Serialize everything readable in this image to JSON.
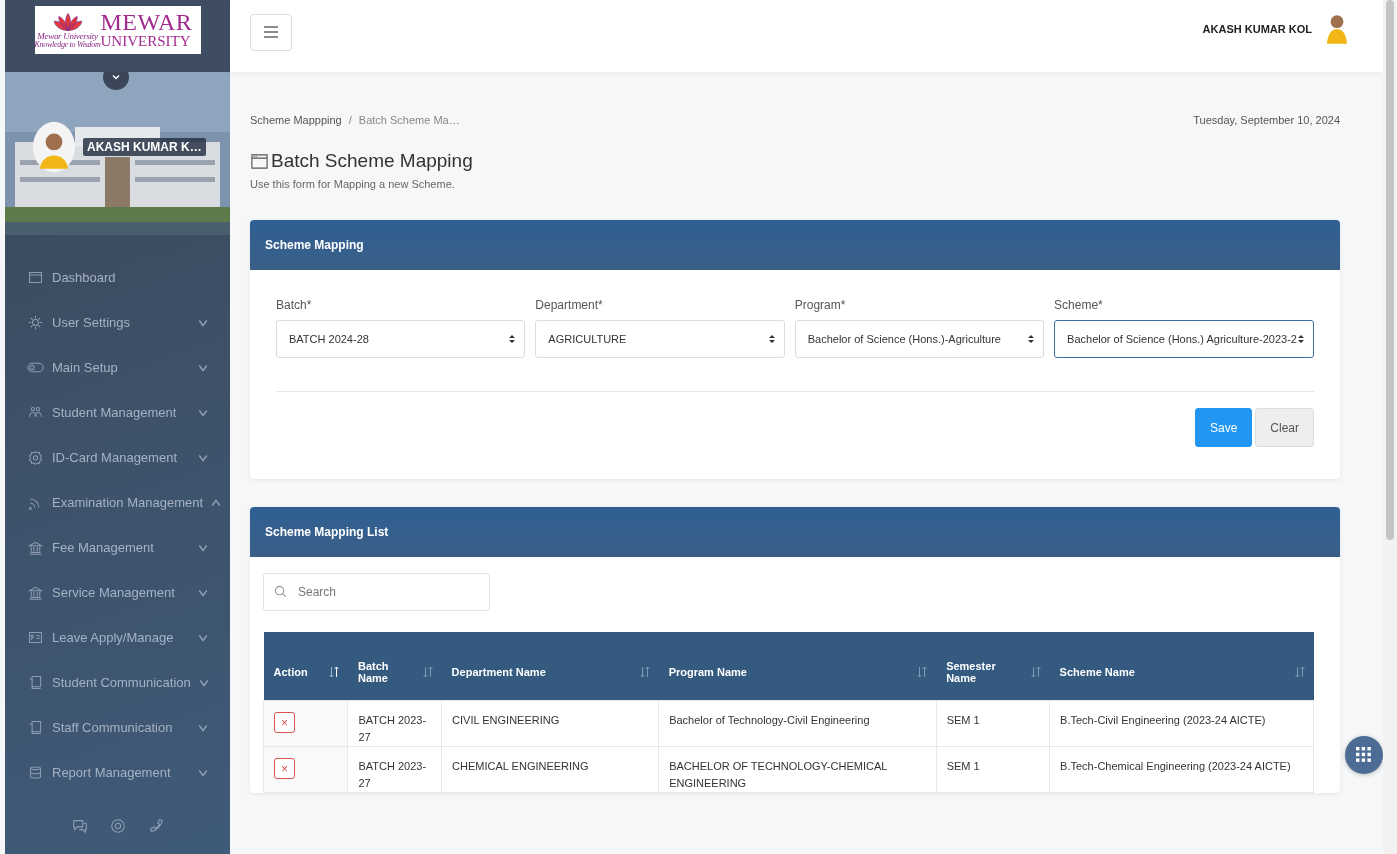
{
  "logo": {
    "title": "MEWAR",
    "subtitle": "UNIVERSITY",
    "motto": "Mewar University",
    "tagline": "Knowledge to Wisdom"
  },
  "sidebar": {
    "user": "AKASH KUMAR K…",
    "items": [
      {
        "label": "Dashboard",
        "expandable": false
      },
      {
        "label": "User Settings",
        "expandable": true,
        "expanded": false
      },
      {
        "label": "Main Setup",
        "expandable": true,
        "expanded": false
      },
      {
        "label": "Student Management",
        "expandable": true,
        "expanded": false
      },
      {
        "label": "ID-Card Management",
        "expandable": true,
        "expanded": false
      },
      {
        "label": "Examination Management",
        "expandable": true,
        "expanded": true
      },
      {
        "label": "Fee Management",
        "expandable": true,
        "expanded": false
      },
      {
        "label": "Service Management",
        "expandable": true,
        "expanded": false
      },
      {
        "label": "Leave Apply/Manage",
        "expandable": true,
        "expanded": false
      },
      {
        "label": "Student Communication",
        "expandable": true,
        "expanded": false
      },
      {
        "label": "Staff Communication",
        "expandable": true,
        "expanded": false
      },
      {
        "label": "Report Management",
        "expandable": true,
        "expanded": false
      }
    ]
  },
  "header": {
    "user_name": "AKASH KUMAR KOL"
  },
  "breadcrumb": [
    "Scheme Mappping",
    "Batch Scheme Ma…"
  ],
  "breadcrumb_separator": "/",
  "date": "Tuesday, September 10, 2024",
  "page": {
    "title": "Batch Scheme Mapping",
    "subtitle": "Use this form for Mapping a new Scheme."
  },
  "form": {
    "title": "Scheme Mapping",
    "fields": [
      {
        "label": "Batch*",
        "value": "BATCH 2024-28",
        "focused": false
      },
      {
        "label": "Department*",
        "value": "AGRICULTURE",
        "focused": false
      },
      {
        "label": "Program*",
        "value": "Bachelor of Science (Hons.)-Agriculture",
        "focused": false
      },
      {
        "label": "Scheme*",
        "value": "Bachelor of Science (Hons.) Agriculture-2023-2",
        "focused": true
      }
    ],
    "buttons": [
      {
        "label": "Save",
        "kind": "primary"
      },
      {
        "label": "Clear",
        "kind": "secondary"
      }
    ]
  },
  "list": {
    "title": "Scheme Mapping List",
    "search": {
      "placeholder": "Search"
    },
    "columns": [
      "Action",
      "Batch Name",
      "Department Name",
      "Program Name",
      "Semester Name",
      "Scheme Name"
    ],
    "rows": [
      {
        "action": "×",
        "batch": "BATCH 2023-27",
        "department": "CIVIL ENGINEERING",
        "program": "Bachelor of Technology-Civil Engineering",
        "semester": "SEM 1",
        "scheme": "B.Tech-Civil Engineering (2023-24 AICTE)"
      },
      {
        "action": "×",
        "batch": "BATCH 2023-27",
        "department": "CHEMICAL ENGINEERING",
        "program": "BACHELOR OF TECHNOLOGY-CHEMICAL ENGINEERING",
        "semester": "SEM 1",
        "scheme": "B.Tech-Chemical Engineering (2023-24 AICTE)"
      }
    ]
  }
}
